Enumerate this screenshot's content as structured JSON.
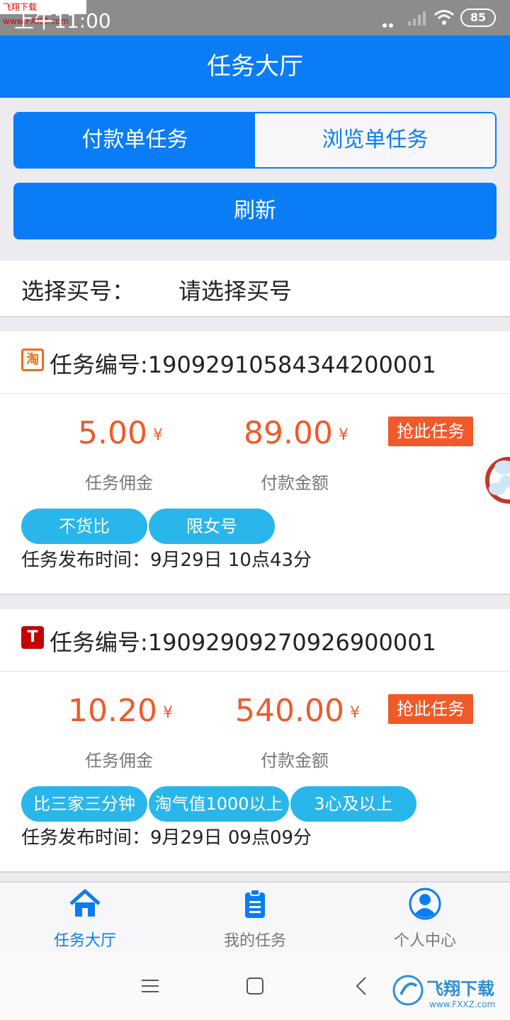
{
  "status_bar": {
    "watermark": "飞翔下载 www.FXXZ.com",
    "time": "上午11:00",
    "battery": "85"
  },
  "title": "任务大厅",
  "tabs": [
    {
      "label": "付款单任务",
      "active": true
    },
    {
      "label": "浏览单任务",
      "active": false
    }
  ],
  "refresh_label": "刷新",
  "buyer_select": {
    "label": "选择买号：",
    "value": "请选择买号"
  },
  "tasks": [
    {
      "shop_icon": "taobao-icon",
      "shop_icon_text": "淘",
      "task_no": "任务编号:19092910584344200001",
      "commission": "5.00",
      "commission_label": "任务佣金",
      "payment": "89.00",
      "payment_label": "付款金额",
      "currency": "¥",
      "grab_label": "抢此任务",
      "tags": [
        "不货比",
        "限女号"
      ],
      "post_time": "任务发布时间：9月29日 10点43分"
    },
    {
      "shop_icon": "tmall-icon",
      "shop_icon_text": "T",
      "task_no": "任务编号:19092909270926900001",
      "commission": "10.20",
      "commission_label": "任务佣金",
      "payment": "540.00",
      "payment_label": "付款金额",
      "currency": "¥",
      "grab_label": "抢此任务",
      "tags": [
        "比三家三分钟",
        "淘气值1000以上",
        "3心及以上"
      ],
      "post_time": "任务发布时间：9月29日 09点09分"
    }
  ],
  "bottom_nav": [
    {
      "label": "任务大厅",
      "icon": "home-icon",
      "active": true
    },
    {
      "label": "我的任务",
      "icon": "clipboard-icon",
      "active": false
    },
    {
      "label": "个人中心",
      "icon": "user-icon",
      "active": false
    }
  ],
  "brand": {
    "name": "飞翔下载",
    "url": "www.FXXZ.com"
  },
  "colors": {
    "primary": "#0a7cf6",
    "accent": "#f05a2a",
    "tag": "#29b6ea"
  }
}
